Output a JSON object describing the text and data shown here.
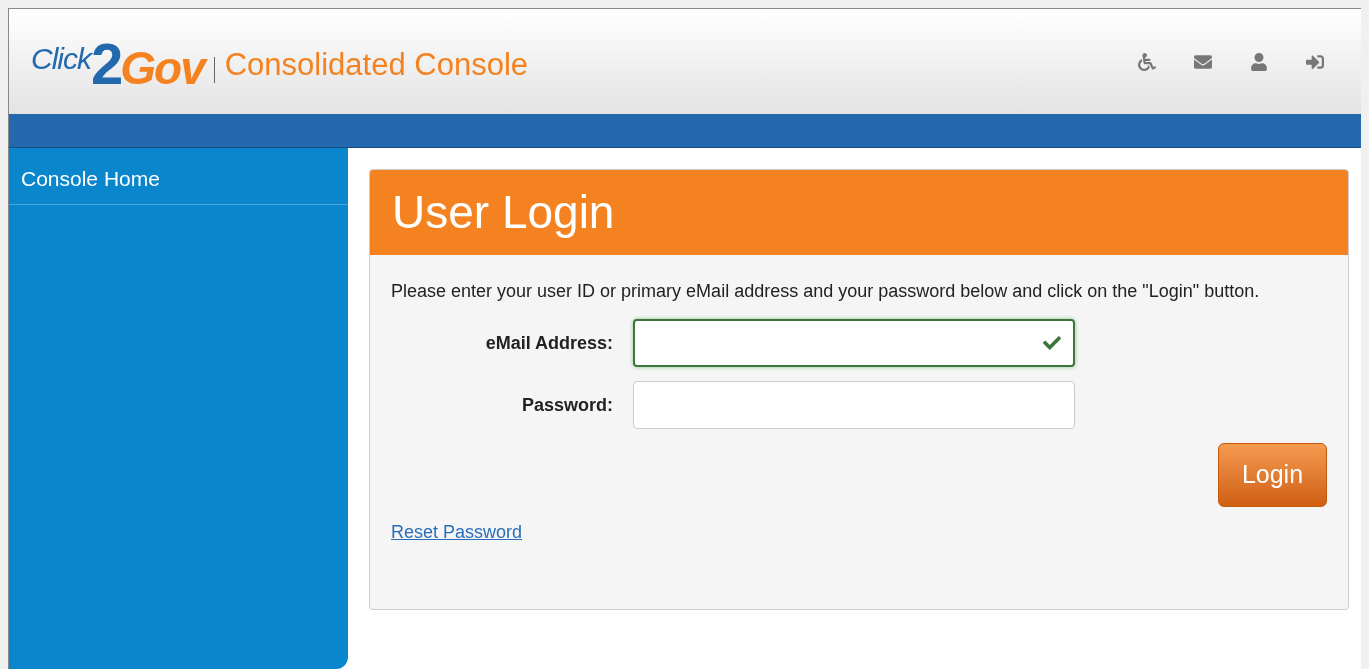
{
  "header": {
    "logo": {
      "part_1": "Click",
      "part_2": "2",
      "part_3": "Gov"
    },
    "app_name": "Consolidated Console"
  },
  "sidebar": {
    "items": [
      {
        "label": "Console Home",
        "selected": false
      }
    ]
  },
  "login": {
    "title": "User Login",
    "instructions": "Please enter your user ID or primary eMail address and your password below and click on the \"Login\" button.",
    "fields": [
      {
        "label": "eMail Address:",
        "valid": true
      },
      {
        "label": "Password:",
        "valid": false
      }
    ],
    "button": "Login",
    "link": "Reset Password"
  }
}
